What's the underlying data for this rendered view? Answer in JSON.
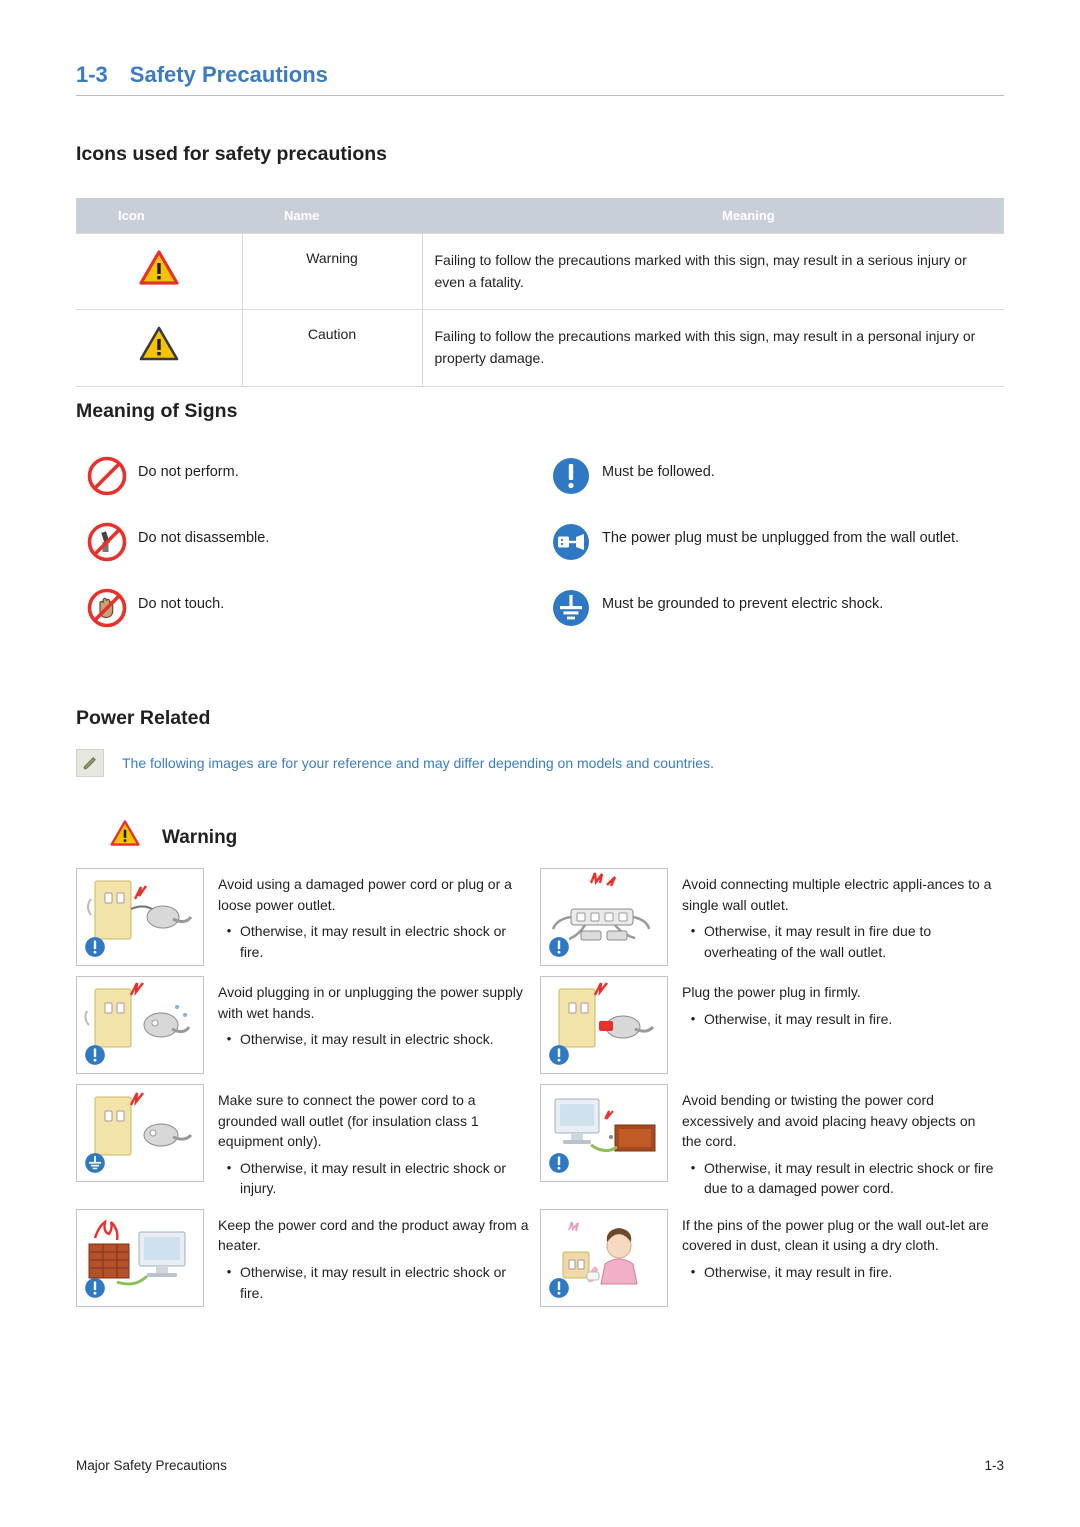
{
  "header": {
    "number": "1-3",
    "title": "Safety Precautions"
  },
  "sections": {
    "icons_heading": "Icons used for safety precautions",
    "signs_heading": "Meaning of Signs",
    "power_heading": "Power Related"
  },
  "icons_table": {
    "columns": [
      "Icon",
      "Name",
      "Meaning"
    ],
    "rows": [
      {
        "icon": "warning-triangle-red-icon",
        "name": "Warning",
        "meaning": "Failing to follow the precautions marked with this sign, may result in a serious injury or even a fatality."
      },
      {
        "icon": "caution-triangle-yellow-icon",
        "name": "Caution",
        "meaning": "Failing to follow the precautions marked with this sign, may result in a personal injury or property damage."
      }
    ]
  },
  "signs": [
    {
      "icon": "prohibition-circle-icon",
      "text": "Do not perform."
    },
    {
      "icon": "must-be-followed-icon",
      "text": "Must be followed."
    },
    {
      "icon": "do-not-disassemble-icon",
      "text": "Do not disassemble."
    },
    {
      "icon": "unplug-power-plug-icon",
      "text": "The power plug must be unplugged from the wall outlet."
    },
    {
      "icon": "do-not-touch-hand-icon",
      "text": "Do not touch."
    },
    {
      "icon": "ground-earth-icon",
      "text": "Must be grounded to prevent electric shock."
    }
  ],
  "note": {
    "icon": "pencil-note-icon",
    "text": "The following images are for your reference and may differ depending on models and countries."
  },
  "warning_heading": {
    "icon": "warning-triangle-red-icon",
    "label": "Warning"
  },
  "warnings": [
    {
      "picture": "damaged-power-cord-illustration",
      "badge": "must-be-followed-icon",
      "text": "Avoid using a damaged power cord or plug or a loose power outlet.",
      "bullets": [
        "Otherwise, it may result in electric shock or fire."
      ]
    },
    {
      "picture": "multiple-plugs-single-outlet-illustration",
      "badge": "must-be-followed-icon",
      "text": "Avoid connecting multiple electric appli-ances to a single wall outlet.",
      "bullets": [
        "Otherwise, it may result in fire due to overheating of the wall outlet."
      ]
    },
    {
      "picture": "wet-hands-plug-illustration",
      "badge": "must-be-followed-icon",
      "text": "Avoid plugging in or unplugging the power supply with wet hands.",
      "bullets": [
        "Otherwise, it may result in electric shock."
      ]
    },
    {
      "picture": "plug-firmly-illustration",
      "badge": "must-be-followed-icon",
      "text": "Plug the power plug in firmly.",
      "bullets": [
        "Otherwise, it may result in fire."
      ]
    },
    {
      "picture": "grounded-wall-outlet-illustration",
      "badge": "ground-earth-icon",
      "text": "Make sure to connect the power cord to a grounded wall outlet (for insulation class 1 equipment only).",
      "bullets": [
        "Otherwise, it may result in electric shock or injury."
      ]
    },
    {
      "picture": "bending-cord-heavy-object-illustration",
      "badge": "must-be-followed-icon",
      "text": "Avoid bending or twisting the power cord excessively and avoid placing heavy objects on the cord.",
      "bullets": [
        "Otherwise, it may result in electric shock or fire due to a damaged power cord."
      ]
    },
    {
      "picture": "heater-away-from-product-illustration",
      "badge": "must-be-followed-icon",
      "text": "Keep the power cord and the product away from a heater.",
      "bullets": [
        "Otherwise, it may result in electric shock or fire."
      ]
    },
    {
      "picture": "clean-dusty-plug-illustration",
      "badge": "must-be-followed-icon",
      "text": "If the pins of the power plug or the wall out-let are covered in dust, clean it using a dry cloth.",
      "bullets": [
        "Otherwise, it may result in fire."
      ]
    }
  ],
  "footer": {
    "left": "Major Safety Precautions",
    "right": "1-3"
  },
  "colors": {
    "accent_blue": "#3a7cc4",
    "table_header_gray": "#c9cfd6",
    "red": "#e8312a",
    "yellow": "#f5c400"
  }
}
